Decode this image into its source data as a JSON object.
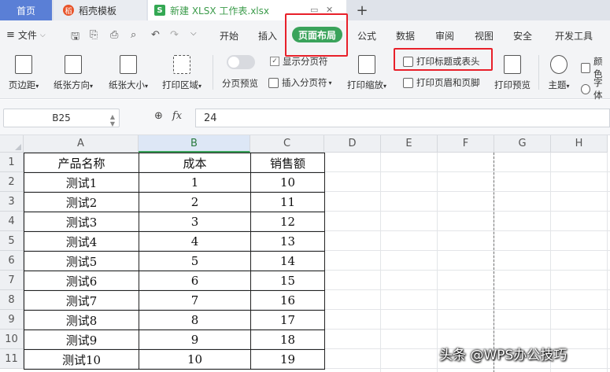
{
  "tabs": {
    "home": "首页",
    "daoke": "稻壳模板",
    "daoke_icon": "稻",
    "file": "新建 XLSX 工作表.xlsx",
    "file_icon": "S",
    "add": "+"
  },
  "menu": {
    "file": "文件",
    "items": [
      "开始",
      "插入",
      "页面布局",
      "公式",
      "数据",
      "审阅",
      "视图",
      "安全",
      "开发工具"
    ],
    "active": "页面布局"
  },
  "ribbon": {
    "margins": "页边距",
    "orientation": "纸张方向",
    "size": "纸张大小",
    "print_area": "打印区域",
    "page_break_preview": "分页预览",
    "show_page_breaks": "显示分页符",
    "insert_page_break": "插入分页符",
    "print_scale": "打印缩放",
    "print_titles": "打印标题或表头",
    "print_header_footer": "打印页眉和页脚",
    "print_preview": "打印预览",
    "theme": "主题",
    "colors": "颜色",
    "fonts": "字体"
  },
  "formula_bar": {
    "cell_ref": "B25",
    "value": "24"
  },
  "grid": {
    "columns": [
      "A",
      "B",
      "C",
      "D",
      "E",
      "F",
      "G",
      "H"
    ],
    "selected_column": "B",
    "row_numbers": [
      "1",
      "2",
      "3",
      "4",
      "5",
      "6",
      "7",
      "8",
      "9",
      "10",
      "11"
    ],
    "rows": [
      [
        "产品名称",
        "成本",
        "销售额"
      ],
      [
        "测试1",
        "1",
        "10"
      ],
      [
        "测试2",
        "2",
        "11"
      ],
      [
        "测试3",
        "3",
        "12"
      ],
      [
        "测试4",
        "4",
        "13"
      ],
      [
        "测试5",
        "5",
        "14"
      ],
      [
        "测试6",
        "6",
        "15"
      ],
      [
        "测试7",
        "7",
        "16"
      ],
      [
        "测试8",
        "8",
        "17"
      ],
      [
        "测试9",
        "9",
        "18"
      ],
      [
        "测试10",
        "10",
        "19"
      ]
    ]
  },
  "watermark": "头条 @WPS办公技巧",
  "colors": {
    "accent_green": "#3aa35b",
    "highlight_red": "#e8202a",
    "home_tab_blue": "#5a7fd6"
  }
}
